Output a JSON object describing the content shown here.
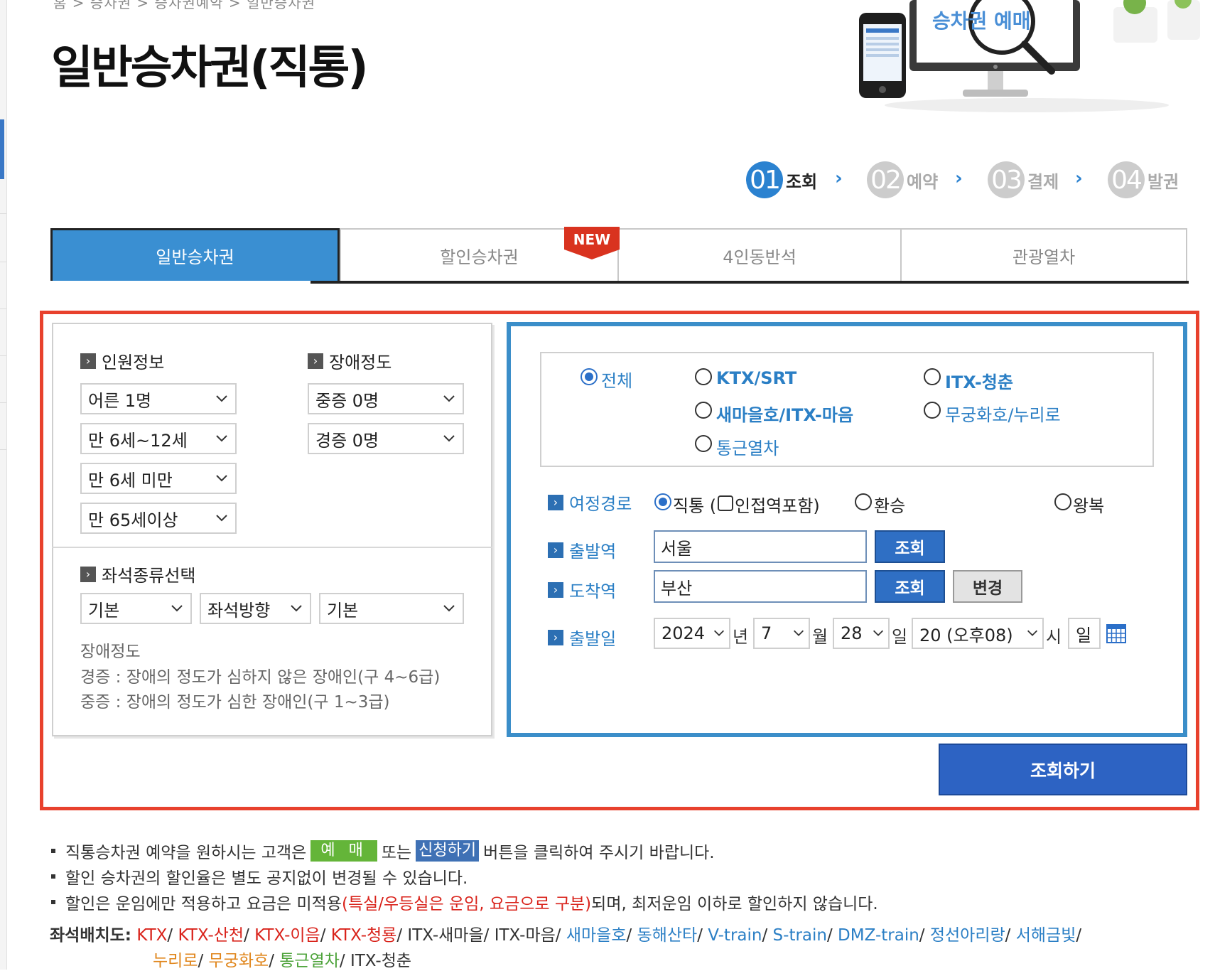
{
  "breadcrumb": "홈 > 승차권 > 승차권예약 > 일반승차권",
  "page_title": "일반승차권(직통)",
  "banner": {
    "text": "승차권 예매"
  },
  "steps": [
    {
      "num": "01",
      "label": "조회",
      "active": true
    },
    {
      "num": "02",
      "label": "예약",
      "active": false
    },
    {
      "num": "03",
      "label": "결제",
      "active": false
    },
    {
      "num": "04",
      "label": "발권",
      "active": false
    }
  ],
  "tabs": [
    {
      "label": "일반승차권",
      "active": true
    },
    {
      "label": "할인승차권",
      "active": false
    },
    {
      "label": "4인동반석",
      "active": false
    },
    {
      "label": "관광열차",
      "active": false
    }
  ],
  "new_badge": "NEW",
  "passenger": {
    "title": "인원정보",
    "selects": [
      "어른 1명",
      "만 6세~12세",
      "만 6세 미만",
      "만 65세이상"
    ]
  },
  "disability": {
    "title": "장애정도",
    "selects": [
      "중증 0명",
      "경증 0명"
    ]
  },
  "seat": {
    "title": "좌석종류선택",
    "selects": [
      "기본",
      "좌석방향",
      "기본"
    ]
  },
  "disability_note": {
    "title": "장애정도",
    "line1": "경증 : 장애의 정도가 심하지 않은 장애인(구 4~6급)",
    "line2": "중증 : 장애의 정도가 심한 장애인(구 1~3급)"
  },
  "train_types": [
    {
      "label": "전체",
      "checked": true
    },
    {
      "label": "KTX/SRT",
      "checked": false
    },
    {
      "label": "ITX-청춘",
      "checked": false
    },
    {
      "label": "새마을호/ITX-마음",
      "checked": false
    },
    {
      "label": "무궁화호/누리로",
      "checked": false
    },
    {
      "label": "통근열차",
      "checked": false
    }
  ],
  "route": {
    "label": "여정경로",
    "direct": "직통 (",
    "nearby": "인접역포함)",
    "transfer": "환승",
    "roundtrip": "왕복"
  },
  "departure": {
    "label": "출발역",
    "value": "서울",
    "button": "조회"
  },
  "arrival": {
    "label": "도착역",
    "value": "부산",
    "button": "조회",
    "swap_button": "변경"
  },
  "date": {
    "label": "출발일",
    "year": "2024",
    "year_unit": "년",
    "month": "7",
    "month_unit": "월",
    "day": "28",
    "day_unit": "일",
    "hour": "20 (오후08)",
    "hour_unit": "시",
    "weekday": "일"
  },
  "search_button": "조회하기",
  "notes": {
    "line1_a": "직통승차권 예약을 원하시는 고객은",
    "tag_green": "예 매",
    "line1_b": "또는",
    "tag_blue": "신청하기",
    "line1_c": "버튼을 클릭하여 주시기 바랍니다.",
    "line2": "할인 승차권의 할인율은 별도 공지없이 변경될 수 있습니다.",
    "line3_a": "할인은 운임에만 적용하고 요금은 미적용",
    "line3_red": "(특실/우등실은 운임, 요금으로 구분)",
    "line3_b": "되며, 최저운임 이하로 할인하지 않습니다."
  },
  "seat_map": {
    "label": "좌석배치도:",
    "row1": [
      {
        "t": "KTX",
        "c": "red"
      },
      {
        "t": "/ ",
        "c": "dark"
      },
      {
        "t": "KTX-산천",
        "c": "red"
      },
      {
        "t": "/ ",
        "c": "dark"
      },
      {
        "t": "KTX-이음",
        "c": "red"
      },
      {
        "t": "/ ",
        "c": "dark"
      },
      {
        "t": "KTX-청룡",
        "c": "red"
      },
      {
        "t": "/ ",
        "c": "dark"
      },
      {
        "t": "ITX-새마을",
        "c": "dark"
      },
      {
        "t": "/ ",
        "c": "dark"
      },
      {
        "t": "ITX-마음",
        "c": "dark"
      },
      {
        "t": "/ ",
        "c": "dark"
      },
      {
        "t": "새마을호",
        "c": "sky"
      },
      {
        "t": "/ ",
        "c": "dark"
      },
      {
        "t": "동해산타",
        "c": "sky"
      },
      {
        "t": "/ ",
        "c": "dark"
      },
      {
        "t": "V-train",
        "c": "sky"
      },
      {
        "t": "/ ",
        "c": "dark"
      },
      {
        "t": "S-train",
        "c": "sky"
      },
      {
        "t": "/ ",
        "c": "dark"
      },
      {
        "t": "DMZ-train",
        "c": "sky"
      },
      {
        "t": "/ ",
        "c": "dark"
      },
      {
        "t": "정선아리랑",
        "c": "sky"
      },
      {
        "t": "/ ",
        "c": "dark"
      },
      {
        "t": "서해금빛",
        "c": "sky"
      },
      {
        "t": "/",
        "c": "dark"
      }
    ],
    "row2": [
      {
        "t": "누리로",
        "c": "orange"
      },
      {
        "t": "/ ",
        "c": "dark"
      },
      {
        "t": "무궁화호",
        "c": "orange"
      },
      {
        "t": "/ ",
        "c": "dark"
      },
      {
        "t": "통근열차",
        "c": "green"
      },
      {
        "t": "/ ",
        "c": "dark"
      },
      {
        "t": "ITX-청춘",
        "c": "dark"
      }
    ]
  },
  "colors": {
    "accent_blue": "#3a8fd2",
    "frame_red": "#e8412d",
    "button_blue": "#2d63c3",
    "step_active": "#2b82d0",
    "step_inactive": "#cccccc"
  }
}
